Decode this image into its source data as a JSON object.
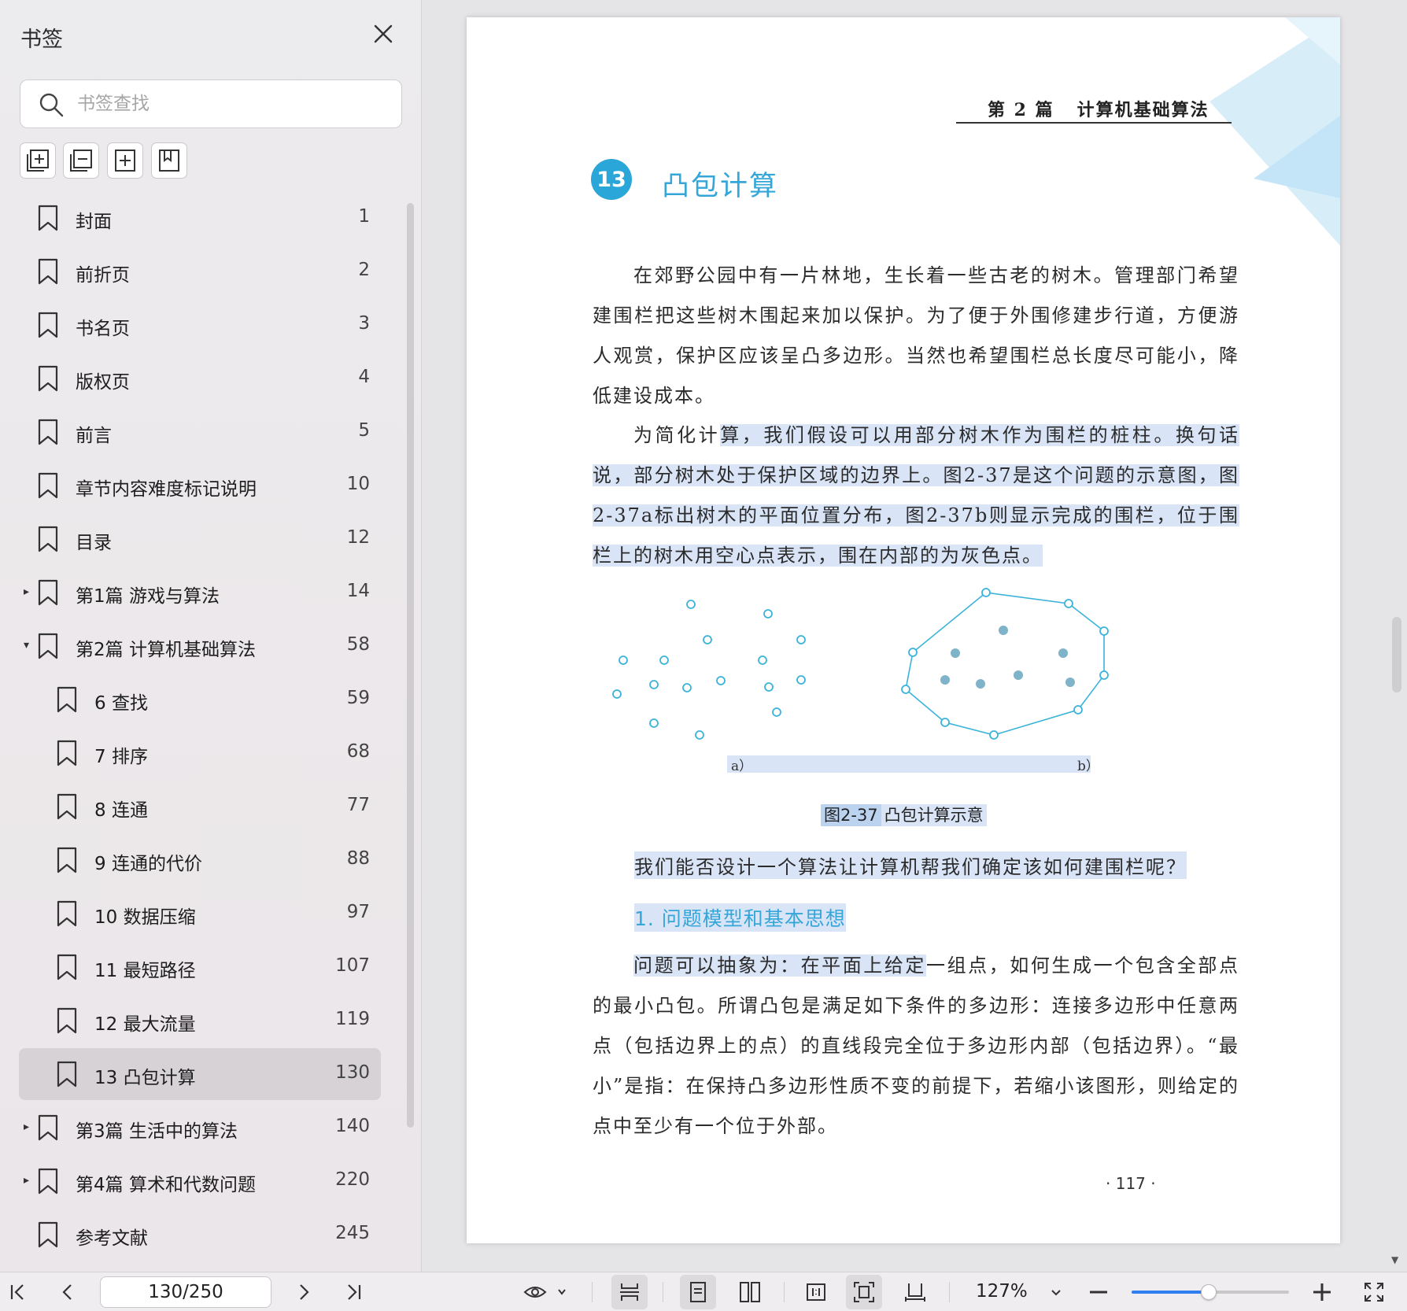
{
  "sidebar": {
    "title": "书签",
    "search_placeholder": "书签查找",
    "tools": [
      "expand-all-icon",
      "collapse-all-icon",
      "add-bookmark-icon",
      "bookmark-icon"
    ],
    "items": [
      {
        "label": "封面",
        "page": "1",
        "level": 0,
        "toggle": ""
      },
      {
        "label": "前折页",
        "page": "2",
        "level": 0,
        "toggle": ""
      },
      {
        "label": "书名页",
        "page": "3",
        "level": 0,
        "toggle": ""
      },
      {
        "label": "版权页",
        "page": "4",
        "level": 0,
        "toggle": ""
      },
      {
        "label": "前言",
        "page": "5",
        "level": 0,
        "toggle": ""
      },
      {
        "label": "章节内容难度标记说明",
        "page": "10",
        "level": 0,
        "toggle": ""
      },
      {
        "label": "目录",
        "page": "12",
        "level": 0,
        "toggle": ""
      },
      {
        "label": "第1篇 游戏与算法",
        "page": "14",
        "level": 0,
        "toggle": "▸"
      },
      {
        "label": "第2篇 计算机基础算法",
        "page": "58",
        "level": 0,
        "toggle": "▾"
      },
      {
        "label": "6 查找",
        "page": "59",
        "level": 1,
        "toggle": ""
      },
      {
        "label": "7 排序",
        "page": "68",
        "level": 1,
        "toggle": ""
      },
      {
        "label": "8 连通",
        "page": "77",
        "level": 1,
        "toggle": ""
      },
      {
        "label": "9 连通的代价",
        "page": "88",
        "level": 1,
        "toggle": ""
      },
      {
        "label": "10 数据压缩",
        "page": "97",
        "level": 1,
        "toggle": ""
      },
      {
        "label": "11 最短路径",
        "page": "107",
        "level": 1,
        "toggle": ""
      },
      {
        "label": "12 最大流量",
        "page": "119",
        "level": 1,
        "toggle": ""
      },
      {
        "label": "13 凸包计算",
        "page": "130",
        "level": 1,
        "toggle": "",
        "active": true
      },
      {
        "label": "第3篇 生活中的算法",
        "page": "140",
        "level": 0,
        "toggle": "▸"
      },
      {
        "label": "第4篇 算术和代数问题",
        "page": "220",
        "level": 0,
        "toggle": "▸"
      },
      {
        "label": "参考文献",
        "page": "245",
        "level": 0,
        "toggle": ""
      }
    ]
  },
  "page": {
    "header": "第 2 篇   计算机基础算法",
    "chapter_number": "13",
    "chapter_title": "凸包计算",
    "para1": "在郊野公园中有一片林地，生长着一些古老的树木。管理部门希望建围栏把这些树木围起来加以保护。为了便于外围修建步行道，方便游人观赏，保护区应该呈凸多边形。当然也希望围栏总长度尽可能小，降低建设成本。",
    "para2_plain": "为简化计",
    "para2_highlight": "算，我们假设可以用部分树木作为围栏的桩柱。换句话说，部分树木处于保护区域的边界上。图2-37是这个问题的示意图，图2-37a标出树木的平面位置分布，图2-37b则显示完成的围栏，位于围栏上的树木用空心点表示，围在内部的为灰色点。",
    "figure_a": "a）",
    "figure_b": "b）",
    "figure_label": "图2-37",
    "figure_caption": "凸包计算示意",
    "question": "我们能否设计一个算法让计算机帮我们确定该如何建围栏呢？",
    "section_heading": "1.  问题模型和基本思想",
    "para3_highlight": "问题可以抽象为：在平面上给定",
    "para3_plain": "一组点，如何生成一个包含全部点的最小凸包。所谓凸包是满足如下条件的多边形：连接多边形中任意两点（包括边界上的点）的直线段完全位于多边形内部（包括边界）。“最小”是指：在保持凸多边形性质不变的前提下，若缩小该图形，则给定的点中至少有一个位于外部。",
    "page_number": "· 117 ·"
  },
  "toolbar": {
    "page_value": "130/250",
    "zoom": "127%",
    "zoom_level": 0.49
  },
  "colors": {
    "accent_blue": "#35a6d8",
    "highlight": "#d9e4f7",
    "slider_blue": "#2f7ff0",
    "point_outline": "#3bb3da",
    "point_fill": "#7fb3c9"
  }
}
